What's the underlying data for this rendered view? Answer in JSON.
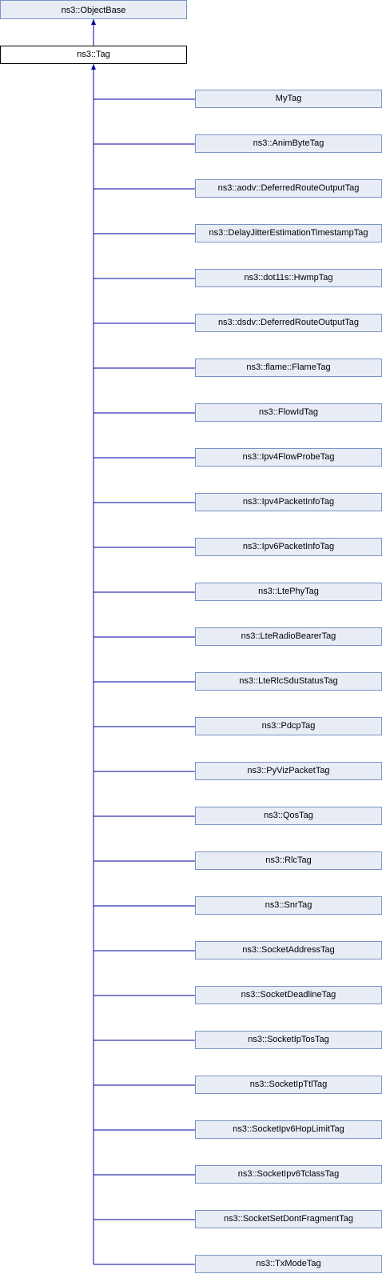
{
  "base": "ns3::ObjectBase",
  "current": "ns3::Tag",
  "children": [
    "MyTag",
    "ns3::AnimByteTag",
    "ns3::aodv::DeferredRouteOutputTag",
    "ns3::DelayJitterEstimationTimestampTag",
    "ns3::dot11s::HwmpTag",
    "ns3::dsdv::DeferredRouteOutputTag",
    "ns3::flame::FlameTag",
    "ns3::FlowIdTag",
    "ns3::Ipv4FlowProbeTag",
    "ns3::Ipv4PacketInfoTag",
    "ns3::Ipv6PacketInfoTag",
    "ns3::LtePhyTag",
    "ns3::LteRadioBearerTag",
    "ns3::LteRlcSduStatusTag",
    "ns3::PdcpTag",
    "ns3::PyVizPacketTag",
    "ns3::QosTag",
    "ns3::RlcTag",
    "ns3::SnrTag",
    "ns3::SocketAddressTag",
    "ns3::SocketDeadlineTag",
    "ns3::SocketIpTosTag",
    "ns3::SocketIpTtlTag",
    "ns3::SocketIpv6HopLimitTag",
    "ns3::SocketIpv6TclassTag",
    "ns3::SocketSetDontFragmentTag",
    "ns3::TxModeTag"
  ],
  "colors": {
    "edge": "#0000a0",
    "node_border": "#7b93c4",
    "node_fill": "#e8ecf5"
  }
}
